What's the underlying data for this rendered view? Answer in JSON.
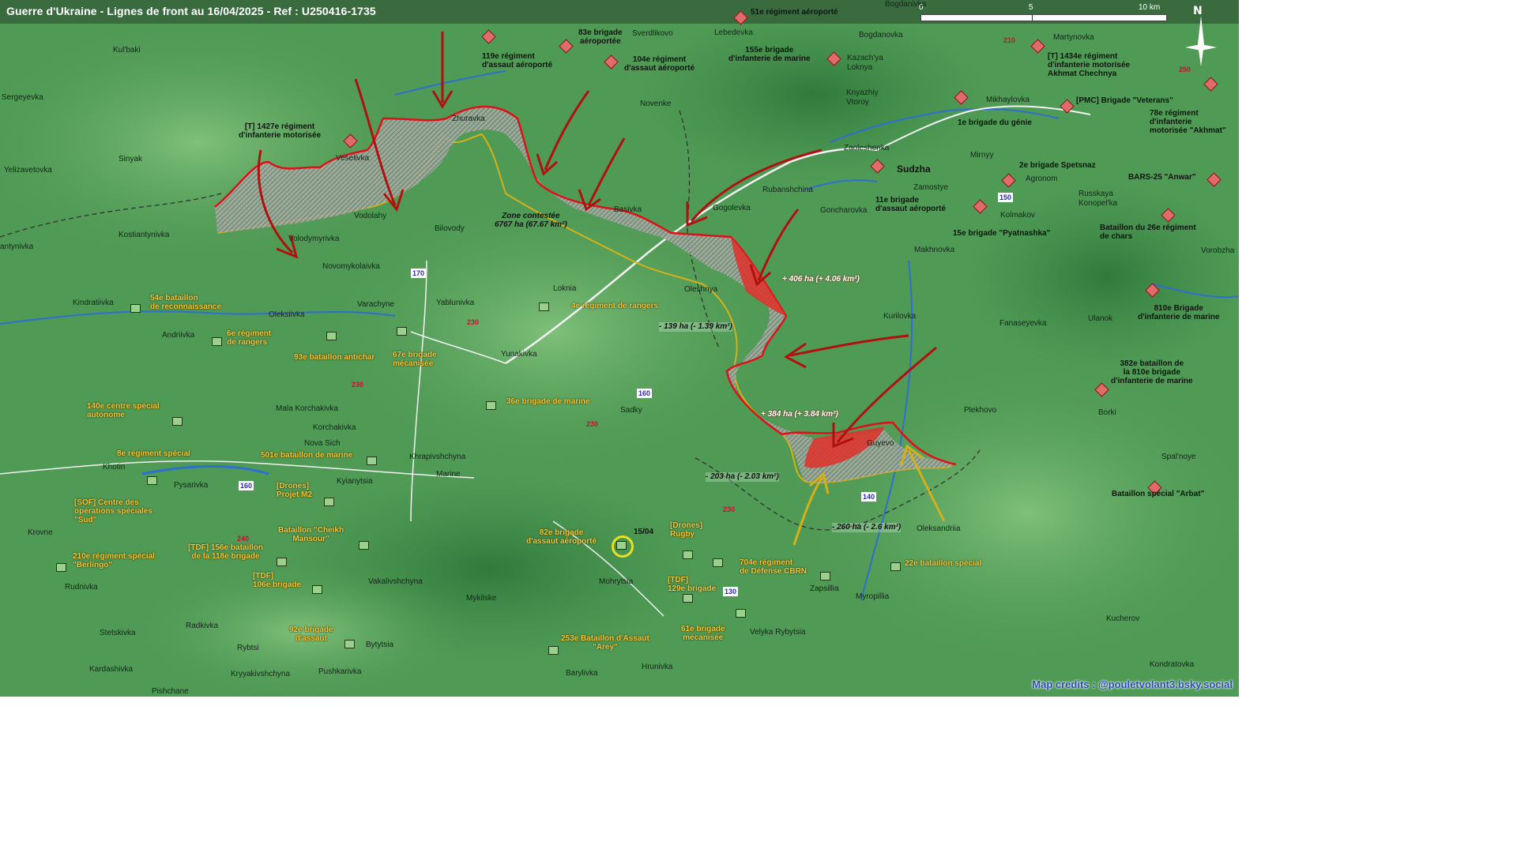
{
  "title": "Guerre d'Ukraine - Lignes de front au 16/04/2025 - Ref : U250416-1735",
  "scale": {
    "labels": [
      "0",
      "5",
      "10 km"
    ]
  },
  "north": "N",
  "credits": "Map credits : @pouletvolant3.bsky.social",
  "colors": {
    "ru_front": "#e0101a",
    "ua_front": "#d6b018",
    "contested": "#9aa39a",
    "gain": "#e0302a"
  },
  "places": [
    "Kul'baki",
    "Sergeyevka",
    "Sinyak",
    "Yelizavetovka",
    "Kostiantynivka",
    "antynivka",
    "Kindratiivka",
    "Oleksiivka",
    "Andriivka",
    "Veselivka",
    "Vodolahy",
    "Volodymyrivka",
    "Novomykolaivka",
    "Bilovody",
    "Varachyne",
    "Yablunivka",
    "Zhuravka",
    "Novenke",
    "Basivka",
    "Loknia",
    "Yunakivka",
    "Sadky",
    "Oleshnya",
    "Gogolevka",
    "Goncharovka",
    "Rubanshchina",
    "Zaoleshenka",
    "Sudzha",
    "Mirnyy",
    "Zamostye",
    "Agronom",
    "Kolmakov",
    "Makhnovka",
    "Kurilovka",
    "Fanaseyevka",
    "Ulanok",
    "Plekhovo",
    "Borki",
    "Spal'noye",
    "Guyevo",
    "Oleksandriia",
    "Zapsillia",
    "Myropillia",
    "Kucherov",
    "Kondratovka",
    "Vorobzha",
    "Russkaya Konopel'ka",
    "Sverdlikovo",
    "Lebedevka",
    "Bogdanovka",
    "Kazach'ya Loknya",
    "Knyazhiy Vtoroy",
    "Martynovka",
    "Mikhaylovka",
    "Mala Korchakivka",
    "Korchakivka",
    "Nova Sich",
    "Khrapivshchyna",
    "Marine",
    "Kyianytsia",
    "Pysarivka",
    "Khotin",
    "Krovne",
    "Rudnivka",
    "Vakalivshchyna",
    "Mykilske",
    "Mohrytsia",
    "Barylivka",
    "Hrunivka",
    "Velyka Rybytsia",
    "Bytytsia",
    "Rybtsi",
    "Kryyakivshchyna",
    "Pushkarivka",
    "Stetskivka",
    "Kardashivka",
    "Pishchane",
    "Radkivka",
    "Bogdanivka"
  ],
  "ru_units": [
    "51e régiment aéroporté",
    "83e brigade\naéroportée",
    "119e régiment\nd'assaut aéroporté",
    "104e régiment\nd'assaut aéroporté",
    "155e brigade\nd'infanterie de marine",
    "[T] 1427e régiment\nd'infanterie motorisée",
    "[T] 1434e régiment\nd'infanterie motorisée\nAkhmat Chechnya",
    "[PMC] Brigade \"Veterans\"",
    "78e régiment\nd'infanterie\nmotorisée \"Akhmat\"",
    "1e brigade du génie",
    "2e brigade Spetsnaz",
    "BARS-25 \"Anwar\"",
    "11e brigade\nd'assaut aéroporté",
    "15e brigade \"Pyatnashka\"",
    "Bataillon du 26e régiment\nde chars",
    "810e Brigade\nd'infanterie de marine",
    "382e bataillon de\nla 810e brigade\nd'infanterie de marine",
    "Bataillon spécial \"Arbat\""
  ],
  "ua_units": [
    "54e bataillon\nde reconnaissance",
    "6e régiment\nde rangers",
    "93e bataillon antichar",
    "67e brigade\nmécanisée",
    "4e régiment de rangers",
    "140e centre spécial\nautonome",
    "36e brigade de marine",
    "8e régiment spécial",
    "501e bataillon de marine",
    "[Drones]\nProjet M2",
    "[SOF] Centre des\nopérations spéciales\n\"Sud\"",
    "Bataillon \"Cheikh\nMansour\"",
    "[TDF] 156e bataillon\nde la 118e brigade",
    "210e régiment spécial\n\"Berlingo\"",
    "[TDF]\n106e brigade",
    "82e brigade\nd'assaut aéroporté",
    "[Drones]\nRugby",
    "704e régiment\nde Défense CBRN",
    "[TDF]\n129e brigade",
    "22e bataillon spécial",
    "92e brigade\nd'assaut",
    "61e brigade\nmécanisée",
    "253e Bataillon d'Assaut\n\"Arey\""
  ],
  "roads": [
    "210",
    "250",
    "170",
    "230",
    "230",
    "160",
    "230",
    "160",
    "240",
    "230",
    "150",
    "140",
    "130"
  ],
  "annotations": {
    "zone": "Zone contestée\n6767 ha (67.67 km²)",
    "gain1": "+ 406 ha (+ 4.06 km²)",
    "gain2": "+ 384 ha (+ 3.84 km²)",
    "loss1": "- 139 ha (- 1.39 km²)",
    "loss2": "- 203 ha (- 2.03 km²)",
    "loss3": "- 260 ha (- 2.6 km²)",
    "date_marker": "15/04"
  }
}
